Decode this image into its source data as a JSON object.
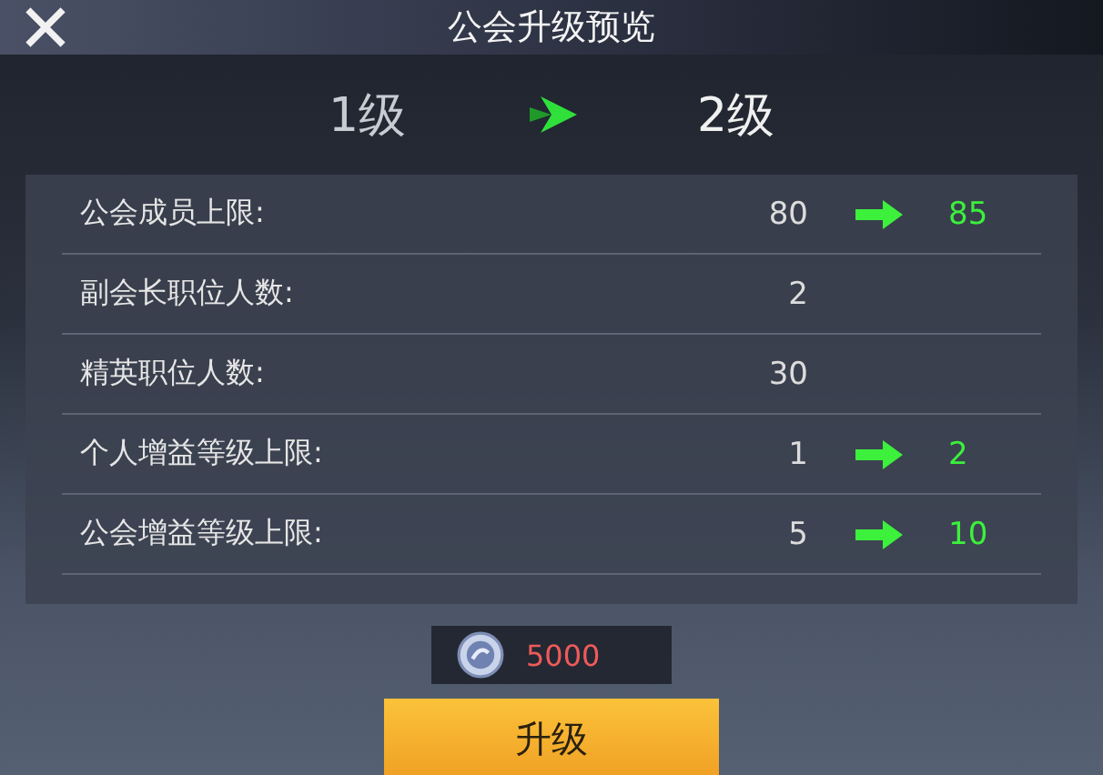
{
  "window": {
    "title": "公会升级预览"
  },
  "levels": {
    "from": "1级",
    "to": "2级"
  },
  "rows": [
    {
      "label": "公会成员上限:",
      "current": "80",
      "next": "85"
    },
    {
      "label": "副会长职位人数:",
      "current": "2"
    },
    {
      "label": "精英职位人数:",
      "current": "30"
    },
    {
      "label": "个人增益等级上限:",
      "current": "1",
      "next": "2"
    },
    {
      "label": "公会增益等级上限:",
      "current": "5",
      "next": "10"
    }
  ],
  "cost": {
    "amount": "5000"
  },
  "upgrade_button": "升级"
}
